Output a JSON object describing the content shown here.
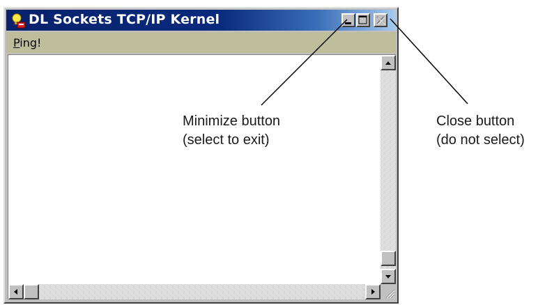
{
  "window": {
    "title": "DL Sockets TCP/IP Kernel",
    "menu": [
      {
        "label": "Ping!",
        "mnemonic": "P"
      }
    ]
  },
  "titlebar_buttons": [
    {
      "name": "minimize",
      "icon": "minimize-icon"
    },
    {
      "name": "maximize",
      "icon": "maximize-icon"
    },
    {
      "name": "close",
      "icon": "close-icon",
      "disabled": true
    }
  ],
  "annotations": {
    "minimize": {
      "line1": "Minimize button",
      "line2": "(select to exit)"
    },
    "close": {
      "line1": "Close button",
      "line2": "(do not select)"
    }
  },
  "colors": {
    "titlebar_start": "#08216b",
    "titlebar_end": "#a6caf0",
    "menubar": "#bdbd9c",
    "face": "#c0c0c0"
  }
}
